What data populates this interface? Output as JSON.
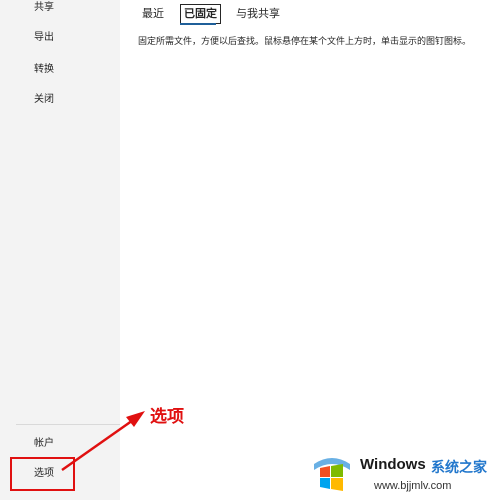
{
  "sidebar": {
    "items": [
      {
        "label": "共享"
      },
      {
        "label": "导出"
      },
      {
        "label": "转换"
      },
      {
        "label": "关闭"
      }
    ],
    "bottom_items": [
      {
        "label": "帐户"
      },
      {
        "label": "选项"
      }
    ]
  },
  "tabs": [
    {
      "label": "最近"
    },
    {
      "label": "已固定",
      "active": true
    },
    {
      "label": "与我共享"
    }
  ],
  "main": {
    "description": "固定所需文件，方便以后查找。鼠标悬停在某个文件上方时，单击显示的图钉图标。"
  },
  "annotation": {
    "label": "选项",
    "color": "#e01010"
  },
  "watermark": {
    "brand": "Windows",
    "cn": "系统之家",
    "url": "www.bjjmlv.com"
  },
  "colors": {
    "sidebar_bg": "#f3f3f3",
    "active_underline": "#1f5f99"
  }
}
